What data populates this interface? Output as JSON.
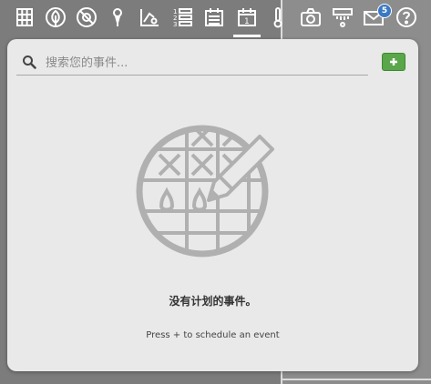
{
  "toolbar": {
    "items": [
      {
        "icon": "grid-icon"
      },
      {
        "icon": "leaf-icon"
      },
      {
        "icon": "no-symbol-icon"
      },
      {
        "icon": "pin-icon"
      },
      {
        "icon": "chart-icon"
      },
      {
        "icon": "numbered-list-icon"
      },
      {
        "icon": "calendar-list-icon"
      },
      {
        "icon": "calendar-icon",
        "active": true,
        "day": "1"
      },
      {
        "icon": "thermometer-icon"
      },
      {
        "icon": "camera-icon"
      },
      {
        "icon": "sprinkler-icon"
      },
      {
        "icon": "mail-icon",
        "badge": "5"
      },
      {
        "icon": "help-icon"
      }
    ]
  },
  "search": {
    "placeholder": "搜索您的事件..."
  },
  "add_button": {
    "label": "+",
    "color": "#5aa64a"
  },
  "empty_state": {
    "title": "没有计划的事件。",
    "hint": "Press + to schedule an event"
  },
  "colors": {
    "panel_bg": "#e9e9e9",
    "accent_blue": "#3b78c4",
    "illustration_gray": "#b0b0b0"
  }
}
